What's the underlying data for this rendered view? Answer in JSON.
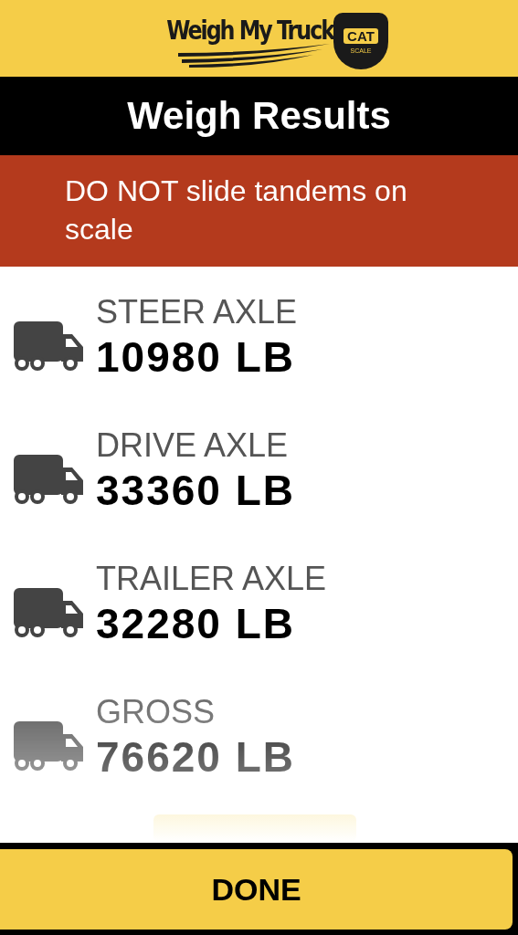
{
  "logo": {
    "wordmark": "Weigh My Truck",
    "badge": "CAT",
    "badge_sub": "SCALE"
  },
  "title": "Weigh Results",
  "warning": "DO NOT slide tandems on scale",
  "results": [
    {
      "label": "STEER AXLE",
      "value": "10980 LB"
    },
    {
      "label": "DRIVE AXLE",
      "value": "33360 LB"
    },
    {
      "label": "TRAILER AXLE",
      "value": "32280 LB"
    },
    {
      "label": "GROSS",
      "value": "76620 LB"
    }
  ],
  "done_button": "DONE"
}
